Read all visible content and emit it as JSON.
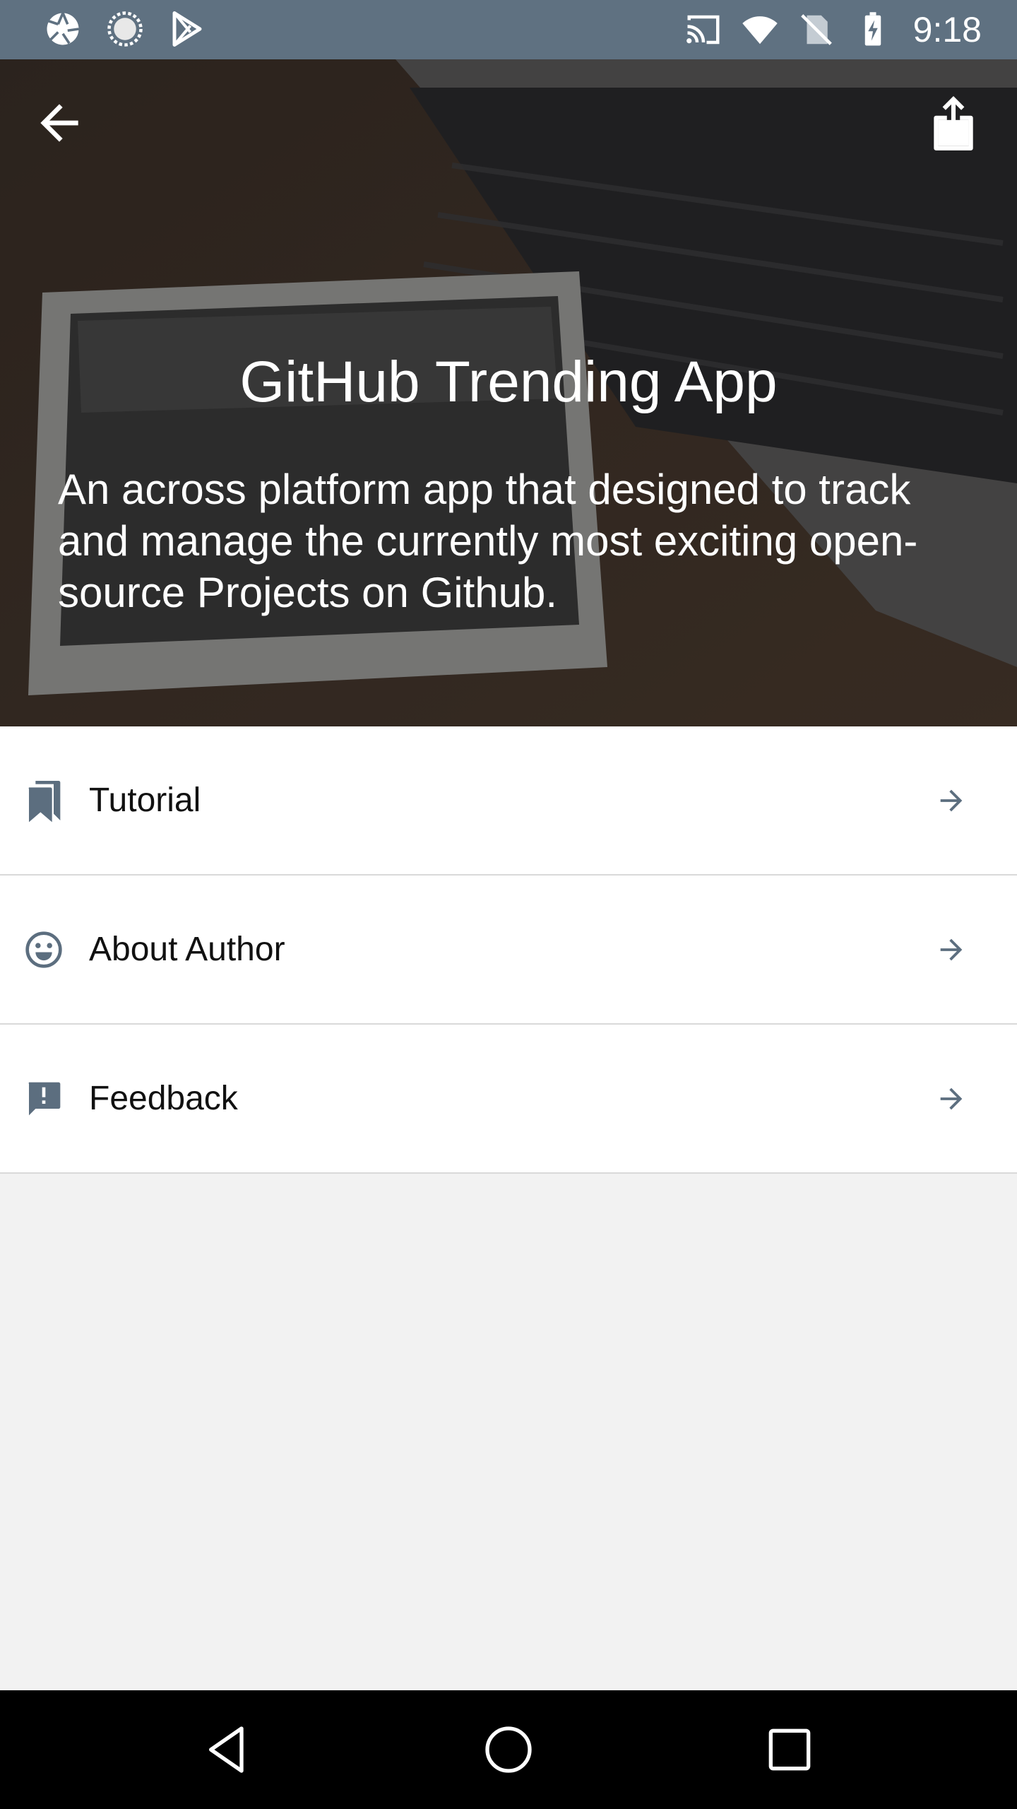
{
  "status_bar": {
    "time": "9:18",
    "left_icons": [
      "aperture-icon",
      "sync-icon",
      "play-store-icon"
    ],
    "right_icons": [
      "cast-icon",
      "wifi-icon",
      "no-sim-icon",
      "battery-charging-icon"
    ]
  },
  "hero": {
    "title": "GitHub Trending App",
    "description": "An across platform app that designed to track and manage the currently most exciting open-source Projects on Github.",
    "back_icon": "back-arrow-icon",
    "share_icon": "share-icon"
  },
  "menu": {
    "items": [
      {
        "label": "Tutorial",
        "icon": "bookmarks-icon"
      },
      {
        "label": "About Author",
        "icon": "smiley-icon"
      },
      {
        "label": "Feedback",
        "icon": "feedback-icon"
      }
    ],
    "arrow_icon": "arrow-right-icon"
  },
  "nav_bar": {
    "buttons": [
      "back-triangle-icon",
      "home-circle-icon",
      "recents-square-icon"
    ]
  },
  "colors": {
    "status_bar": "#5f7181",
    "icon_tint": "#5c6e7f",
    "page_bg": "#f2f2f2",
    "nav_bar": "#000000"
  }
}
